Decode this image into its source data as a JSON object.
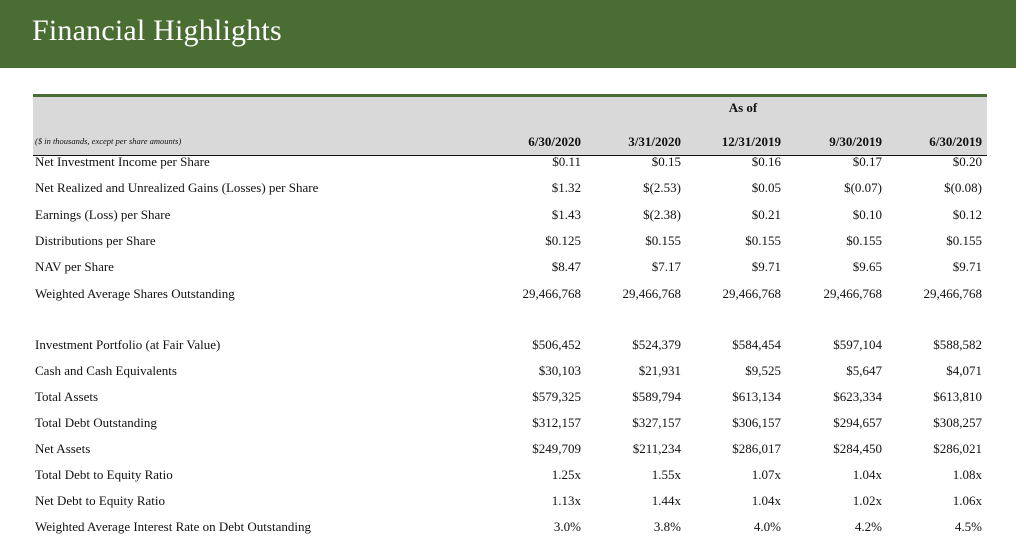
{
  "page_title": "Financial Highlights",
  "table": {
    "as_of_label": "As of",
    "units_note": "($ in thousands, except per share amounts)",
    "columns": [
      "6/30/2020",
      "3/31/2020",
      "12/31/2019",
      "9/30/2019",
      "6/30/2019"
    ],
    "section1": [
      {
        "label": "Net Investment Income per Share",
        "values": [
          "$0.11",
          "$0.15",
          "$0.16",
          "$0.17",
          "$0.20"
        ]
      },
      {
        "label": "Net Realized and Unrealized Gains (Losses) per Share",
        "values": [
          "$1.32",
          "$(2.53)",
          "$0.05",
          "$(0.07)",
          "$(0.08)"
        ]
      },
      {
        "label": "Earnings (Loss) per Share",
        "values": [
          "$1.43",
          "$(2.38)",
          "$0.21",
          "$0.10",
          "$0.12"
        ]
      },
      {
        "label": "Distributions per Share",
        "values": [
          "$0.125",
          "$0.155",
          "$0.155",
          "$0.155",
          "$0.155"
        ]
      },
      {
        "label": "NAV per Share",
        "values": [
          "$8.47",
          "$7.17",
          "$9.71",
          "$9.65",
          "$9.71"
        ]
      },
      {
        "label": "Weighted Average Shares Outstanding",
        "values": [
          "29,466,768",
          "29,466,768",
          "29,466,768",
          "29,466,768",
          "29,466,768"
        ]
      }
    ],
    "section2": [
      {
        "label": "Investment Portfolio (at Fair Value)",
        "values": [
          "$506,452",
          "$524,379",
          "$584,454",
          "$597,104",
          "$588,582"
        ]
      },
      {
        "label": "Cash and Cash Equivalents",
        "values": [
          "$30,103",
          "$21,931",
          "$9,525",
          "$5,647",
          "$4,071"
        ]
      },
      {
        "label": "Total Assets",
        "values": [
          "$579,325",
          "$589,794",
          "$613,134",
          "$623,334",
          "$613,810"
        ]
      },
      {
        "label": "Total Debt Outstanding",
        "values": [
          "$312,157",
          "$327,157",
          "$306,157",
          "$294,657",
          "$308,257"
        ]
      },
      {
        "label": "Net Assets",
        "values": [
          "$249,709",
          "$211,234",
          "$286,017",
          "$284,450",
          "$286,021"
        ]
      },
      {
        "label": "Total Debt to Equity Ratio",
        "values": [
          "1.25x",
          "1.55x",
          "1.07x",
          "1.04x",
          "1.08x"
        ]
      },
      {
        "label": "Net Debt to Equity Ratio",
        "values": [
          "1.13x",
          "1.44x",
          "1.04x",
          "1.02x",
          "1.06x"
        ]
      },
      {
        "label": "Weighted Average Interest Rate on Debt Outstanding",
        "values": [
          "3.0%",
          "3.8%",
          "4.0%",
          "4.2%",
          "4.5%"
        ]
      }
    ]
  }
}
